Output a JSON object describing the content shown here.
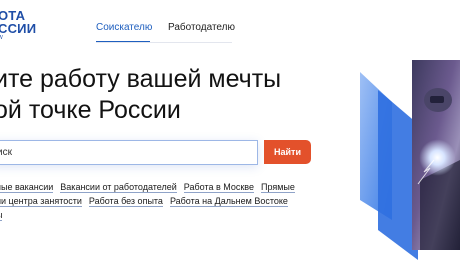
{
  "logo": {
    "line1": "ОТА",
    "line2": "ССИИ",
    "sub": "W"
  },
  "tabs": [
    {
      "label": "Соискателю",
      "active": true
    },
    {
      "label": "Работодателю",
      "active": false
    }
  ],
  "hero": {
    "line1": "ите работу вашей мечты",
    "line2": "ой точке России"
  },
  "search": {
    "placeholder": "иск",
    "button_label": "Найти"
  },
  "quick_links": {
    "row1": [
      "ные вакансии",
      "Вакансии от работодателей",
      "Работа в Москве",
      "Прямые"
    ],
    "row2": [
      "ии центра занятости",
      "Работа без опыта",
      "Работа на Дальнем Востоке"
    ],
    "row3": [
      "ы"
    ]
  },
  "colors": {
    "brand_blue": "#1f4ea7",
    "tab_active": "#1f5fbf",
    "search_button": "#e3512b"
  }
}
